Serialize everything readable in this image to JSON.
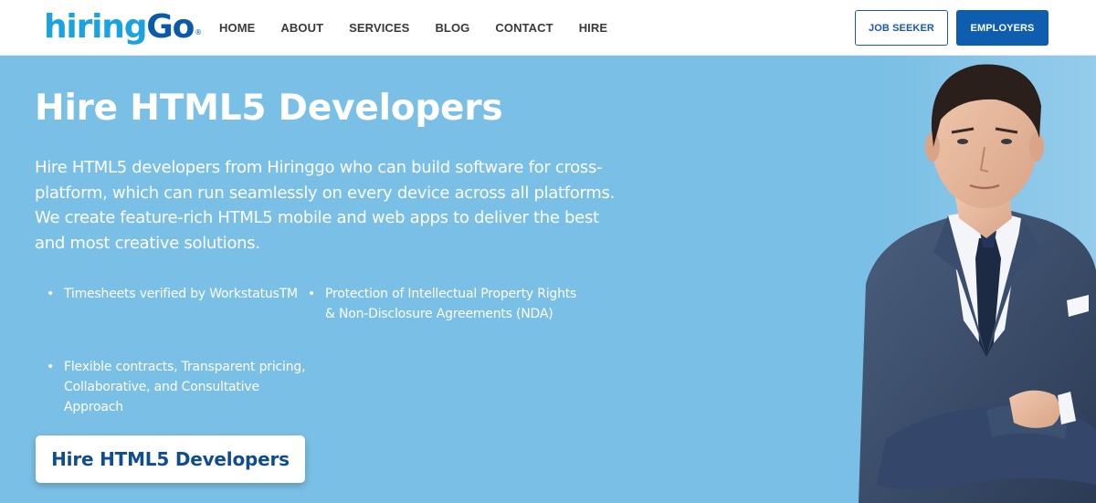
{
  "header": {
    "logo": {
      "part1": "hiring",
      "part2": "Go",
      "mark": "®"
    },
    "nav": [
      {
        "label": "HOME"
      },
      {
        "label": "ABOUT"
      },
      {
        "label": "SERVICES"
      },
      {
        "label": "BLOG"
      },
      {
        "label": "CONTACT"
      },
      {
        "label": "HIRE"
      }
    ],
    "job_seeker_label": "JOB SEEKER",
    "employers_label": "EMPLOYERS"
  },
  "hero": {
    "title": "Hire HTML5 Developers",
    "description": "Hire HTML5 developers from Hiringgo who can build software for cross-platform, which can run seamlessly on every device across all platforms. We create feature-rich HTML5 mobile and web apps to deliver the best and most creative solutions.",
    "bullets": [
      {
        "dot": "•",
        "text": "Timesheets verified by WorkstatusTM"
      },
      {
        "dot": "•",
        "text": "Protection of Intellectual Property Rights & Non-Disclosure Agreements (NDA)"
      },
      {
        "dot": "•",
        "text": "Flexible contracts, Transparent pricing, Collaborative, and Consultative Approach"
      }
    ],
    "cta_label": "Hire HTML5 Developers"
  },
  "colors": {
    "hero_bg": "#7abfe5",
    "brand_light": "#1ba3df",
    "brand_dark": "#0b5aa8",
    "employers_bg": "#0f5dae",
    "cta_text": "#0f4d8f"
  }
}
